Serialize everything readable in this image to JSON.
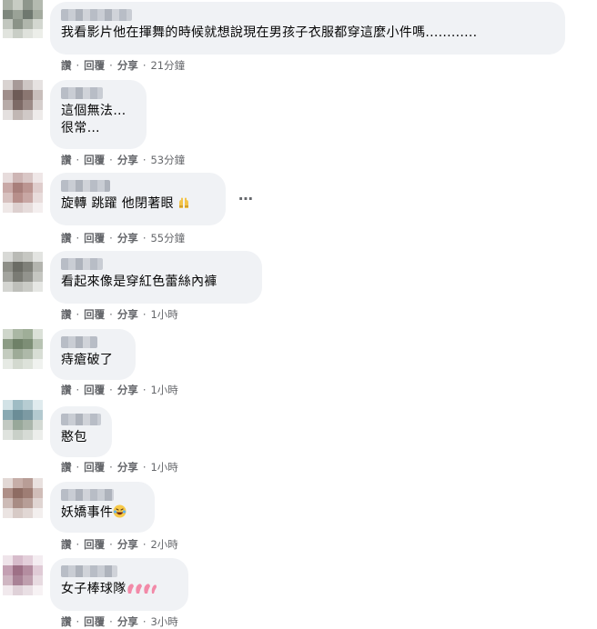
{
  "actions": {
    "like": "讚",
    "reply": "回覆",
    "share": "分享",
    "sep": "·"
  },
  "more_icon": "⋯",
  "comments": [
    {
      "text": "我看影片他在揮舞的時候就想說現在男孩子衣服都穿這麼小件嗎............",
      "time": "21分鐘"
    },
    {
      "text": "這個無法…\n很常…",
      "time": "53分鐘"
    },
    {
      "text": "旋轉 跳躍 他閉著眼",
      "emoji": "raised-hands",
      "time": "55分鐘"
    },
    {
      "text": "看起來像是穿紅色蕾絲內褲",
      "time": "1小時"
    },
    {
      "text": "痔瘡破了",
      "time": "1小時"
    },
    {
      "text": "憨包",
      "time": "1小時"
    },
    {
      "text": "妖嬌事件",
      "emoji": "laughing-face",
      "time": "2小時"
    },
    {
      "text": "女子棒球隊",
      "emoji": "pink-hearts",
      "time": "3小時"
    }
  ]
}
